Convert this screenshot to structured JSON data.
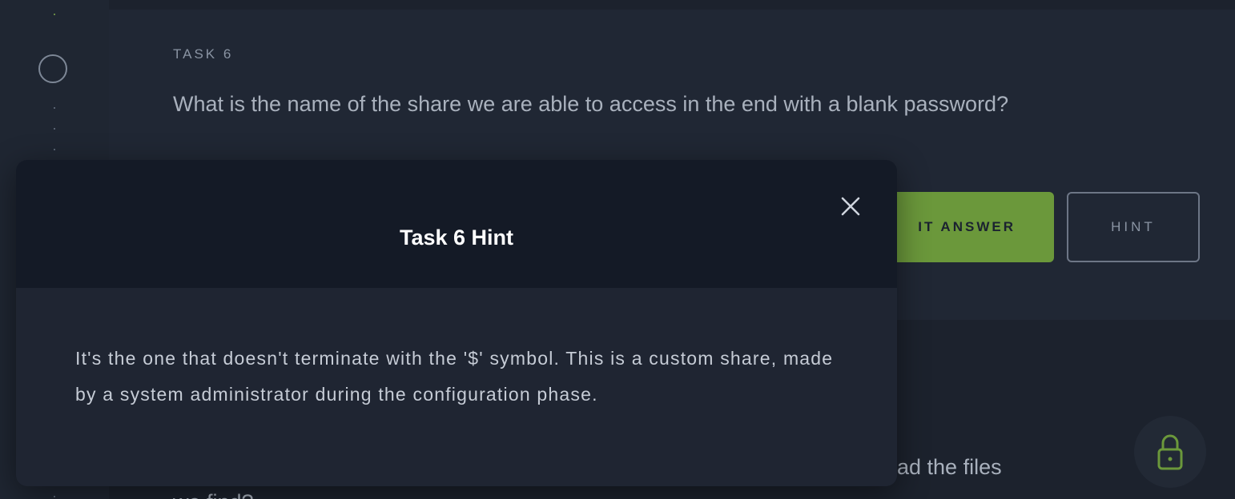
{
  "task": {
    "label": "TASK 6",
    "question": "What is the name of the share we are able to access in the end with a blank password?",
    "submit_label": "IT ANSWER",
    "hint_label": "HINT"
  },
  "next_task": {
    "question_fragment": "ad the files",
    "question_fragment_2": "we find?"
  },
  "modal": {
    "title": "Task 6 Hint",
    "body": "It's the one that doesn't terminate with the '$' symbol. This is a custom share, made by a system administrator during the configuration phase."
  },
  "colors": {
    "accent_green": "#6b983b",
    "background": "#1c222d",
    "modal_header": "#141a26"
  },
  "icons": {
    "close": "close-icon",
    "lock": "lock-icon",
    "step": "step-circle-icon"
  }
}
